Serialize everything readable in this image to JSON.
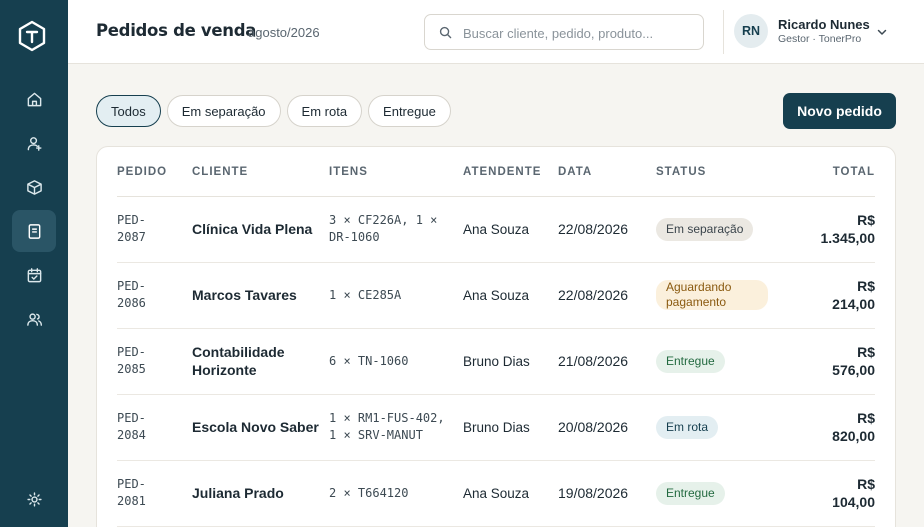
{
  "header": {
    "title": "Pedidos de venda",
    "period": "agosto/2026"
  },
  "search": {
    "placeholder": "Buscar cliente, pedido, produto..."
  },
  "user": {
    "initials": "RN",
    "name": "Ricardo Nunes",
    "role": "Gestor · TonerPro"
  },
  "sidebar": {
    "items": [
      {
        "icon": "home-icon"
      },
      {
        "icon": "user-contact-icon"
      },
      {
        "icon": "box-icon"
      },
      {
        "icon": "orders-icon",
        "active": true
      },
      {
        "icon": "calendar-icon"
      },
      {
        "icon": "team-icon"
      }
    ],
    "settings_icon": "gear-icon"
  },
  "filters": [
    "Todos",
    "Em separação",
    "Em rota",
    "Entregue"
  ],
  "actions": {
    "new_order": "Novo pedido"
  },
  "table": {
    "columns": [
      "PEDIDO",
      "CLIENTE",
      "ITENS",
      "ATENDENTE",
      "DATA",
      "STATUS",
      "TOTAL"
    ],
    "rows": [
      {
        "id": "PED-\n2087",
        "client": "Clínica Vida Plena",
        "items": "3 × CF226A, 1 ×\nDR-1060",
        "agent": "Ana Souza",
        "date": "22/08/2026",
        "status": "Em separação",
        "total": "R$\n1.345,00"
      },
      {
        "id": "PED-\n2086",
        "client": "Marcos Tavares",
        "items": "1 × CE285A",
        "agent": "Ana Souza",
        "date": "22/08/2026",
        "status": "Aguardando pagamento",
        "total": "R$\n214,00"
      },
      {
        "id": "PED-\n2085",
        "client": "Contabilidade Horizonte",
        "items": "6 × TN-1060",
        "agent": "Bruno Dias",
        "date": "21/08/2026",
        "status": "Entregue",
        "total": "R$\n576,00"
      },
      {
        "id": "PED-\n2084",
        "client": "Escola Novo Saber",
        "items": "1 × RM1-FUS-402,\n1 × SRV-MANUT",
        "agent": "Bruno Dias",
        "date": "20/08/2026",
        "status": "Em rota",
        "total": "R$\n820,00"
      },
      {
        "id": "PED-\n2081",
        "client": "Juliana Prado",
        "items": "2 × T664120",
        "agent": "Ana Souza",
        "date": "19/08/2026",
        "status": "Entregue",
        "total": "R$\n104,00"
      }
    ]
  },
  "colors": {
    "sidebar": "#163f4f",
    "accent": "#163f4f",
    "status_separation": "#ebe8e2",
    "status_awaiting_payment": "#fbf0dc",
    "status_delivered": "#e6f1ea",
    "status_in_route": "#e3eef2"
  }
}
